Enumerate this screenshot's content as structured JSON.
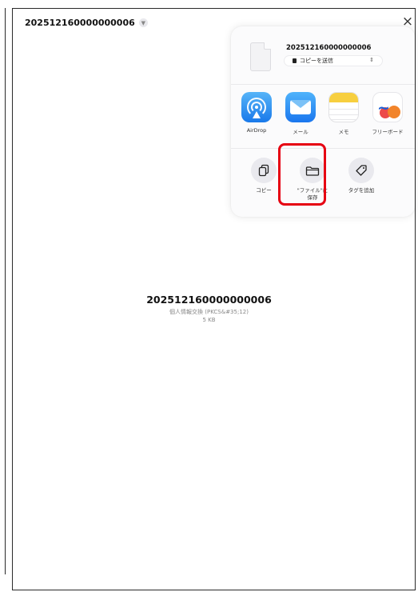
{
  "header": {
    "file_name": "202512160000000006",
    "close_glyph": "×"
  },
  "share_sheet": {
    "file_name": "202512160000000006",
    "send_option": "コピーを送信",
    "apps": [
      {
        "label": "AirDrop",
        "icon": "airdrop-icon"
      },
      {
        "label": "メール",
        "icon": "mail-icon"
      },
      {
        "label": "メモ",
        "icon": "notes-icon"
      },
      {
        "label": "フリーボード",
        "icon": "freeform-icon"
      }
    ],
    "actions": [
      {
        "label": "コピー",
        "icon": "copy-icon"
      },
      {
        "label": "\"ファイル\"に\n保存",
        "icon": "folder-icon"
      },
      {
        "label": "タグを追加",
        "icon": "tag-icon"
      }
    ],
    "highlight_color": "#e60012"
  },
  "preview": {
    "file_name": "202512160000000006",
    "file_type": "個人情報交換 (PKCS&#35;12)",
    "file_size": "5 KB"
  }
}
